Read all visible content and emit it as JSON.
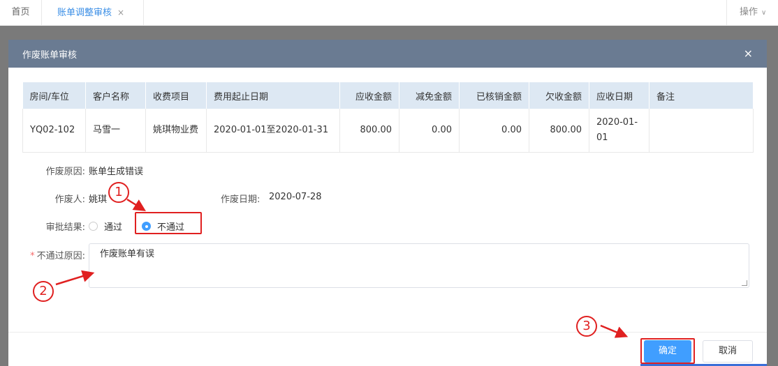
{
  "tabs": {
    "home": "首页",
    "active": "账单调整审核",
    "close_glyph": "×",
    "ops": "操作",
    "ops_chevron": "∨"
  },
  "dialog": {
    "title": "作废账单审核",
    "close_glyph": "×",
    "table": {
      "headers": [
        "房间/车位",
        "客户名称",
        "收费项目",
        "费用起止日期",
        "应收金额",
        "减免金额",
        "已核销金额",
        "欠收金额",
        "应收日期",
        "备注"
      ],
      "row": {
        "room": "YQ02-102",
        "customer": "马雪一",
        "item": "姚琪物业费",
        "period": "2020-01-01至2020-01-31",
        "receivable": "800.00",
        "discount": "0.00",
        "written_off": "0.00",
        "owed": "800.00",
        "due_date": "2020-01-01",
        "remark": ""
      }
    },
    "form": {
      "reason_label": "作废原因:",
      "reason_value": "账单生成错误",
      "voider_label": "作废人:",
      "voider_value": "姚琪",
      "void_date_label": "作废日期:",
      "void_date_value": "2020-07-28",
      "result_label": "审批结果:",
      "option_pass": "通过",
      "option_reject": "不通过",
      "selected": "不通过",
      "reject_reason_required": "*",
      "reject_reason_label": "不通过原因:",
      "reject_reason_value": "作废账单有误"
    },
    "buttons": {
      "ok": "确定",
      "cancel": "取消"
    }
  },
  "annotations": [
    "1",
    "2",
    "3"
  ],
  "colors": {
    "header": "#6a7b92",
    "accent": "#409eff",
    "annotation": "#e02020"
  }
}
